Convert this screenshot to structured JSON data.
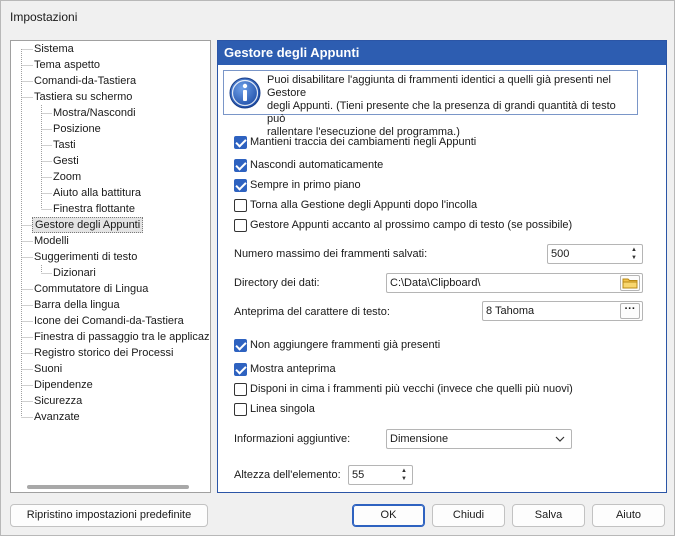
{
  "window": {
    "title": "Impostazioni"
  },
  "tree": {
    "items": [
      {
        "label": "Sistema",
        "level": 0
      },
      {
        "label": "Tema aspetto",
        "level": 0
      },
      {
        "label": "Comandi-da-Tastiera",
        "level": 0
      },
      {
        "label": "Tastiera su schermo",
        "level": 0
      },
      {
        "label": "Mostra/Nascondi",
        "level": 1
      },
      {
        "label": "Posizione",
        "level": 1
      },
      {
        "label": "Tasti",
        "level": 1
      },
      {
        "label": "Gesti",
        "level": 1
      },
      {
        "label": "Zoom",
        "level": 1
      },
      {
        "label": "Aiuto alla battitura",
        "level": 1
      },
      {
        "label": "Finestra flottante",
        "level": 1
      },
      {
        "label": "Gestore degli Appunti",
        "level": 0,
        "selected": true
      },
      {
        "label": "Modelli",
        "level": 0
      },
      {
        "label": "Suggerimenti di testo",
        "level": 0
      },
      {
        "label": "Dizionari",
        "level": 1
      },
      {
        "label": "Commutatore di Lingua",
        "level": 0
      },
      {
        "label": "Barra della lingua",
        "level": 0
      },
      {
        "label": "Icone dei Comandi-da-Tastiera",
        "level": 0
      },
      {
        "label": "Finestra di passaggio tra le applicazioni",
        "level": 0
      },
      {
        "label": "Registro storico dei Processi",
        "level": 0
      },
      {
        "label": "Suoni",
        "level": 0
      },
      {
        "label": "Dipendenze",
        "level": 0
      },
      {
        "label": "Sicurezza",
        "level": 0
      },
      {
        "label": "Avanzate",
        "level": 0
      }
    ]
  },
  "panel": {
    "title": "Gestore degli Appunti",
    "info_line1": "Puoi disabilitare l'aggiunta di frammenti identici a quelli già presenti nel Gestore",
    "info_line2": "degli Appunti. (Tieni presente che la presenza di grandi quantità di testo può",
    "info_line3": "rallentare l'esecuzione del programma.)",
    "checks_top": [
      {
        "label": "Mantieni traccia dei cambiamenti negli Appunti",
        "checked": true
      },
      {
        "label": "Nascondi automaticamente",
        "checked": true
      },
      {
        "label": "Sempre in primo piano",
        "checked": true
      },
      {
        "label": "Torna alla Gestione degli Appunti dopo l'incolla",
        "checked": false
      },
      {
        "label": "Gestore Appunti accanto al prossimo campo di testo (se possibile)",
        "checked": false
      }
    ],
    "max_fragments_label": "Numero massimo dei frammenti salvati:",
    "max_fragments_value": "500",
    "data_dir_label": "Directory dei dati:",
    "data_dir_value": "C:\\Data\\Clipboard\\",
    "font_label": "Anteprima del carattere di testo:",
    "font_value": "8 Tahoma",
    "font_button": "···",
    "checks_bottom": [
      {
        "label": "Non aggiungere frammenti già presenti",
        "checked": true
      },
      {
        "label": "Mostra anteprima",
        "checked": true
      },
      {
        "label": "Disponi in cima i frammenti più vecchi (invece che quelli più nuovi)",
        "checked": false
      },
      {
        "label": "Linea singola",
        "checked": false
      }
    ],
    "extra_info_label": "Informazioni aggiuntive:",
    "extra_info_value": "Dimensione",
    "item_height_label": "Altezza dell'elemento:",
    "item_height_value": "55"
  },
  "buttons": {
    "reset": "Ripristino impostazioni predefinite",
    "ok": "OK",
    "close": "Chiudi",
    "save": "Salva",
    "help": "Aiuto"
  },
  "colors": {
    "accent": "#2d5db1",
    "checkbox": "#2e62c0"
  }
}
